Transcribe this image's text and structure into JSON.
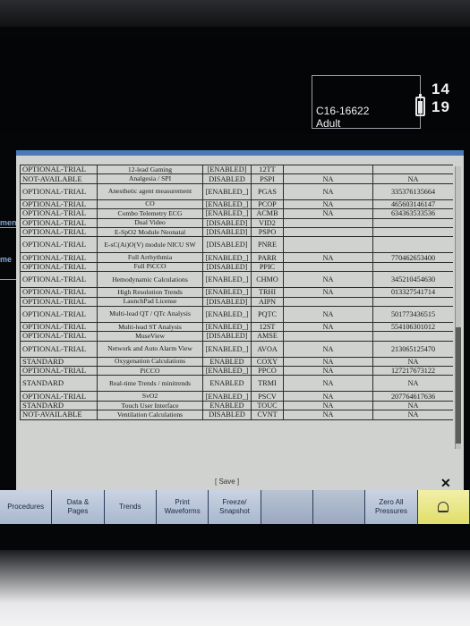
{
  "header": {
    "bed_label": "C16-16622",
    "patient_category": "Adult",
    "clock": "14 19"
  },
  "side_fragments": {
    "upper": "ment",
    "lower": "me"
  },
  "table": {
    "rows": [
      [
        "OPTIONAL-TRIAL",
        "12-lead Gaming",
        "[ENABLED]",
        "12TT",
        "",
        ""
      ],
      [
        "NOT-AVAILABLE",
        "Analgesia / SPI",
        "DISABLED",
        "PSPI",
        "NA",
        "NA"
      ],
      [
        "OPTIONAL-TRIAL",
        "Anesthetic agent measurement",
        "[ENABLED_]",
        "PGAS",
        "NA",
        "335376135664"
      ],
      [
        "OPTIONAL-TRIAL",
        "CO",
        "[ENABLED_]",
        "PCOP",
        "NA",
        "465603146147"
      ],
      [
        "OPTIONAL-TRIAL",
        "Combo Telemetry ECG",
        "[ENABLED_]",
        "ACMB",
        "NA",
        "634363533536"
      ],
      [
        "OPTIONAL-TRIAL",
        "Dual Video",
        "[DISABLED]",
        "VID2",
        "",
        ""
      ],
      [
        "OPTIONAL-TRIAL",
        "E-SpO2 Module Neonatal",
        "[DISABLED]",
        "PSPO",
        "",
        ""
      ],
      [
        "OPTIONAL-TRIAL",
        "E-sC(Ai)O(V) module NICU SW",
        "[DISABLED]",
        "PNRE",
        "",
        ""
      ],
      [
        "OPTIONAL-TRIAL",
        "Full Arrhythmia",
        "[ENABLED_]",
        "PARR",
        "NA",
        "770462653400"
      ],
      [
        "OPTIONAL-TRIAL",
        "Full PiCCO",
        "[DISABLED]",
        "PPIC",
        "",
        ""
      ],
      [
        "OPTIONAL-TRIAL",
        "Hemodynamic Calculations",
        "[ENABLED_]",
        "CHMO",
        "NA",
        "345210454630"
      ],
      [
        "OPTIONAL-TRIAL",
        "High Resolution Trends",
        "[ENABLED_]",
        "TRHI",
        "NA",
        "013327541714"
      ],
      [
        "OPTIONAL-TRIAL",
        "LaunchPad License",
        "[DISABLED]",
        "AIPN",
        "",
        ""
      ],
      [
        "OPTIONAL-TRIAL",
        "Multi-lead QT / QTc Analysis",
        "[ENABLED_]",
        "PQTC",
        "NA",
        "501773436515"
      ],
      [
        "OPTIONAL-TRIAL",
        "Multi-lead ST Analysis",
        "[ENABLED_]",
        "12ST",
        "NA",
        "554106301012"
      ],
      [
        "OPTIONAL-TRIAL",
        "MuseView",
        "[DISABLED]",
        "AMSE",
        "",
        ""
      ],
      [
        "OPTIONAL-TRIAL",
        "Network and Auto Alarm View",
        "[ENABLED_]",
        "AVOA",
        "NA",
        "213065125470"
      ],
      [
        "STANDARD",
        "Oxygenation Calculations",
        "ENABLED",
        "COXY",
        "NA",
        "NA"
      ],
      [
        "OPTIONAL-TRIAL",
        "PiCCO",
        "[ENABLED_]",
        "PPCO",
        "NA",
        "127217673122"
      ],
      [
        "STANDARD",
        "Real-time Trends / minitrends",
        "ENABLED",
        "TRMI",
        "NA",
        "NA"
      ],
      [
        "OPTIONAL-TRIAL",
        "SvO2",
        "[ENABLED_]",
        "PSCV",
        "NA",
        "207764617636"
      ],
      [
        "STANDARD",
        "Touch User Interface",
        "ENABLED",
        "TOUC",
        "NA",
        "NA"
      ],
      [
        "NOT-AVAILABLE",
        "Ventilation Calculations",
        "DISABLED",
        "CVNT",
        "NA",
        "NA"
      ]
    ]
  },
  "save_label": "[ Save ]",
  "softkeys": [
    {
      "label": "Procedures"
    },
    {
      "label": "Data &\nPages"
    },
    {
      "label": "Trends"
    },
    {
      "label": "Print\nWaveforms"
    },
    {
      "label": "Freeze/\nSnapshot"
    },
    {
      "label": ""
    },
    {
      "label": ""
    },
    {
      "label": "Zero All\nPressures"
    },
    {
      "label": ""
    }
  ],
  "colors": {
    "dialog_title": "#4b79b8",
    "softkey": "#c9d3e3",
    "alarm_key": "#e0dd6a"
  }
}
